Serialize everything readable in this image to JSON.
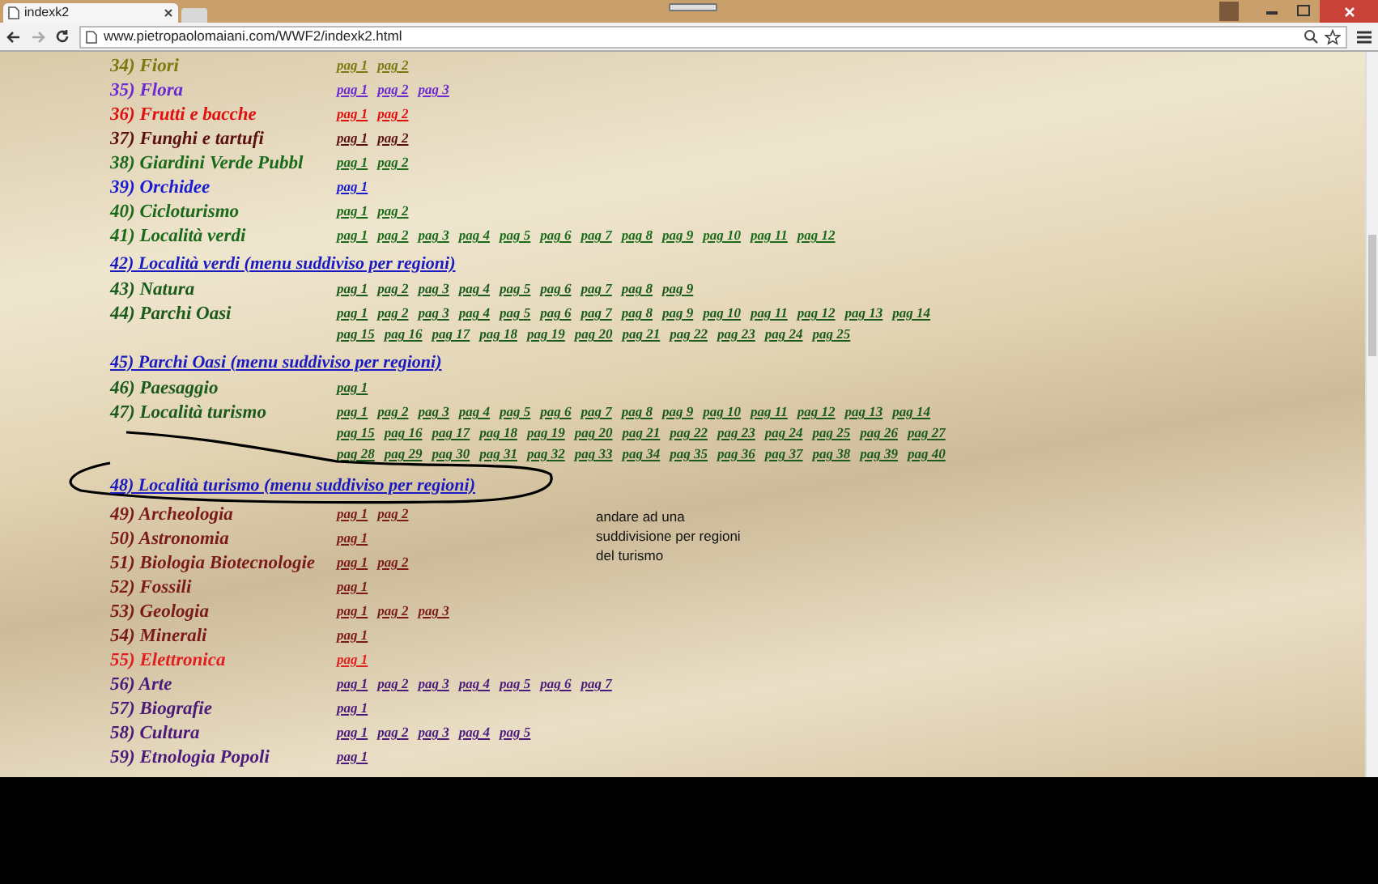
{
  "browser": {
    "tab_title": "indexk2",
    "url": "www.pietropaolomaiani.com/WWF2/indexk2.html"
  },
  "rows": [
    {
      "kind": "category",
      "label": "34) Fiori",
      "color": "#7a7a10",
      "link_lines": [
        [
          "pag 1",
          "pag 2"
        ]
      ]
    },
    {
      "kind": "category",
      "label": "35) Flora",
      "color": "#6a2ad0",
      "link_lines": [
        [
          "pag 1",
          "pag 2",
          "pag 3"
        ]
      ]
    },
    {
      "kind": "category",
      "label": "36) Frutti e bacche",
      "color": "#e01010",
      "link_lines": [
        [
          "pag 1",
          "pag 2"
        ]
      ]
    },
    {
      "kind": "category",
      "label": "37) Funghi e tartufi",
      "color": "#5a1010",
      "link_lines": [
        [
          "pag 1",
          "pag 2"
        ]
      ]
    },
    {
      "kind": "category",
      "label": "38) Giardini Verde Pubbl",
      "color": "#1a6a1a",
      "link_lines": [
        [
          "pag 1",
          "pag 2"
        ]
      ]
    },
    {
      "kind": "category",
      "label": "39) Orchidee",
      "color": "#1a1ad0",
      "link_lines": [
        [
          "pag 1"
        ]
      ]
    },
    {
      "kind": "category",
      "label": "40) Cicloturismo",
      "color": "#1a6a1a",
      "link_lines": [
        [
          "pag 1",
          "pag 2"
        ]
      ]
    },
    {
      "kind": "category",
      "label": "41) Località verdi",
      "color": "#1a6a1a",
      "link_lines": [
        [
          "pag 1",
          "pag 2",
          "pag 3",
          "pag 4",
          "pag 5",
          "pag 6",
          "pag 7",
          "pag 8",
          "pag 9",
          "pag 10",
          "pag 11",
          "pag 12"
        ]
      ]
    },
    {
      "kind": "heading",
      "label": "42) Località verdi (menu suddiviso per regioni)",
      "color": "#1a1ac0"
    },
    {
      "kind": "category",
      "label": "43) Natura",
      "color": "#1a5a1a",
      "link_lines": [
        [
          "pag 1",
          "pag 2",
          "pag 3",
          "pag 4",
          "pag 5",
          "pag 6",
          "pag 7",
          "pag 8",
          "pag 9"
        ]
      ]
    },
    {
      "kind": "category",
      "label": "44) Parchi Oasi",
      "color": "#1a5a1a",
      "link_lines": [
        [
          "pag 1",
          "pag 2",
          "pag 3",
          "pag 4",
          "pag 5",
          "pag 6",
          "pag 7",
          "pag 8",
          "pag 9",
          "pag 10",
          "pag 11",
          "pag 12",
          "pag 13",
          "pag 14"
        ],
        [
          "pag 15",
          "pag 16",
          "pag 17",
          "pag 18",
          "pag 19",
          "pag 20",
          "pag 21",
          "pag 22",
          "pag 23",
          "pag 24",
          "pag 25"
        ]
      ]
    },
    {
      "kind": "heading",
      "label": "45) Parchi Oasi (menu suddiviso per regioni)",
      "color": "#1a1ac0"
    },
    {
      "kind": "category",
      "label": "46) Paesaggio",
      "color": "#1a5a1a",
      "link_lines": [
        [
          "pag 1"
        ]
      ]
    },
    {
      "kind": "category",
      "label": "47) Località turismo",
      "color": "#1a5a1a",
      "link_lines": [
        [
          "pag 1",
          "pag 2",
          "pag 3",
          "pag 4",
          "pag 5",
          "pag 6",
          "pag 7",
          "pag 8",
          "pag 9",
          "pag 10",
          "pag 11",
          "pag 12",
          "pag 13",
          "pag 14"
        ],
        [
          "pag 15",
          "pag 16",
          "pag 17",
          "pag 18",
          "pag 19",
          "pag 20",
          "pag 21",
          "pag 22",
          "pag 23",
          "pag 24",
          "pag 25",
          "pag 26",
          "pag 27"
        ],
        [
          "pag 28",
          "pag 29",
          "pag 30",
          "pag 31",
          "pag 32",
          "pag 33",
          "pag 34",
          "pag 35",
          "pag 36",
          "pag 37",
          "pag 38",
          "pag 39",
          "pag 40"
        ]
      ]
    },
    {
      "kind": "heading",
      "label": "48) Località turismo (menu suddiviso per regioni)",
      "color": "#1a1ac0",
      "circled": true
    },
    {
      "kind": "category",
      "label": "49) Archeologia",
      "color": "#7a1a1a",
      "link_lines": [
        [
          "pag 1",
          "pag 2"
        ]
      ]
    },
    {
      "kind": "category",
      "label": "50) Astronomia",
      "color": "#7a1a1a",
      "link_lines": [
        [
          "pag 1"
        ]
      ]
    },
    {
      "kind": "category",
      "label": "51) Biologia Biotecnologie",
      "color": "#7a1a1a",
      "link_lines": [
        [
          "pag 1",
          "pag 2"
        ]
      ]
    },
    {
      "kind": "category",
      "label": "52) Fossili",
      "color": "#7a1a1a",
      "link_lines": [
        [
          "pag 1"
        ]
      ]
    },
    {
      "kind": "category",
      "label": "53) Geologia",
      "color": "#7a1a1a",
      "link_lines": [
        [
          "pag 1",
          "pag 2",
          "pag 3"
        ]
      ]
    },
    {
      "kind": "category",
      "label": "54) Minerali",
      "color": "#7a1a1a",
      "link_lines": [
        [
          "pag 1"
        ]
      ]
    },
    {
      "kind": "category",
      "label": "55) Elettronica",
      "color": "#e02020",
      "link_lines": [
        [
          "pag 1"
        ]
      ]
    },
    {
      "kind": "category",
      "label": "56) Arte",
      "color": "#4a1a7a",
      "link_lines": [
        [
          "pag 1",
          "pag 2",
          "pag 3",
          "pag 4",
          "pag 5",
          "pag 6",
          "pag 7"
        ]
      ]
    },
    {
      "kind": "category",
      "label": "57) Biografie",
      "color": "#4a1a7a",
      "link_lines": [
        [
          "pag 1"
        ]
      ]
    },
    {
      "kind": "category",
      "label": "58) Cultura",
      "color": "#4a1a7a",
      "link_lines": [
        [
          "pag 1",
          "pag 2",
          "pag 3",
          "pag 4",
          "pag 5"
        ]
      ]
    },
    {
      "kind": "category",
      "label": "59) Etnologia Popoli",
      "color": "#4a1a7a",
      "link_lines": [
        [
          "pag 1"
        ]
      ]
    }
  ],
  "note": "andare ad una suddivisione per regioni del turismo"
}
